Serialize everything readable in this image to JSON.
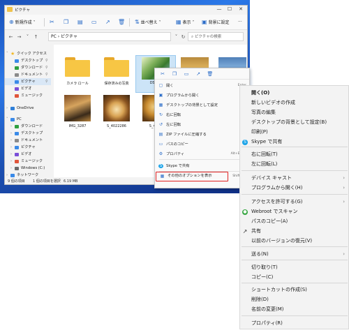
{
  "window": {
    "title": "ピクチャ",
    "controls": [
      "—",
      "☐",
      "✕"
    ]
  },
  "toolbar": {
    "new_label": "新規作成",
    "sort_label": "並べ替え",
    "view_label": "表示",
    "wallpaper_label": "背景に設定",
    "more_label": "···"
  },
  "address": {
    "path": "PC › ピクチャ",
    "search_placeholder": "ピクチャの検索"
  },
  "sidebar": {
    "items": [
      {
        "label": "クイック アクセス",
        "icon": "star-icon",
        "color": "#f2b824"
      },
      {
        "label": "デスクトップ",
        "icon": "desktop-icon",
        "color": "#3a8ae8"
      },
      {
        "label": "ダウンロード",
        "icon": "download-icon",
        "color": "#2f9f3f"
      },
      {
        "label": "ドキュメント",
        "icon": "document-icon",
        "color": "#8a8a8a"
      },
      {
        "label": "ピクチャ",
        "icon": "pictures-icon",
        "color": "#3a8ae8"
      },
      {
        "label": "ビデオ",
        "icon": "video-icon",
        "color": "#7b4ed8"
      },
      {
        "label": "ミュージック",
        "icon": "music-icon",
        "color": "#e0553a"
      },
      {
        "label": "OneDrive",
        "icon": "cloud-icon",
        "color": "#2f7fd8"
      },
      {
        "label": "PC",
        "icon": "pc-icon",
        "color": "#3a8ae8"
      },
      {
        "label": "ダウンロード",
        "icon": "download-icon",
        "color": "#2f9f3f"
      },
      {
        "label": "デスクトップ",
        "icon": "desktop-icon",
        "color": "#3a8ae8"
      },
      {
        "label": "ドキュメント",
        "icon": "document-icon",
        "color": "#8a8a8a"
      },
      {
        "label": "ピクチャ",
        "icon": "pictures-icon",
        "color": "#3a8ae8"
      },
      {
        "label": "ビデオ",
        "icon": "video-icon",
        "color": "#7b4ed8"
      },
      {
        "label": "ミュージック",
        "icon": "music-icon",
        "color": "#e0553a"
      },
      {
        "label": "Windows (C:)",
        "icon": "drive-icon",
        "color": "#6b6b6b"
      },
      {
        "label": "ネットワーク",
        "icon": "network-icon",
        "color": "#3a8ae8"
      }
    ]
  },
  "files": [
    {
      "name": "カメラ ロール",
      "kind": "folder"
    },
    {
      "name": "保存済みの写真",
      "kind": "folder"
    },
    {
      "name": "DSCF0",
      "kind": "photo"
    },
    {
      "name": "",
      "kind": "photo"
    },
    {
      "name": "",
      "kind": "photo"
    },
    {
      "name": "IMG_3287",
      "kind": "photo"
    },
    {
      "name": "S_4022286",
      "kind": "photo"
    },
    {
      "name": "S_4022",
      "kind": "photo"
    }
  ],
  "status": {
    "items": "9 個の項目",
    "selected": "1 個の項目を選択",
    "size": "6.19 MB"
  },
  "context_menu_small": {
    "items": [
      {
        "label": "開く",
        "shortcut": "Enter",
        "icon": "open-icon"
      },
      {
        "label": "プログラムから開く",
        "shortcut": "",
        "icon": "open-with-icon"
      },
      {
        "label": "デスクトップの背景として設定",
        "shortcut": "",
        "icon": "wallpaper-icon"
      },
      {
        "label": "右に回転",
        "shortcut": "",
        "icon": "rotate-right-icon"
      },
      {
        "label": "左に回転",
        "shortcut": "",
        "icon": "rotate-left-icon"
      },
      {
        "label": "ZIP ファイルに圧縮する",
        "shortcut": "",
        "icon": "zip-icon"
      },
      {
        "label": "パスのコピー",
        "shortcut": "",
        "icon": "copy-path-icon"
      },
      {
        "label": "プロパティ",
        "shortcut": "Alt+Enter",
        "icon": "properties-icon"
      },
      {
        "label": "Skype で共有",
        "shortcut": "",
        "icon": "skype-icon"
      },
      {
        "label": "その他のオプションを表示",
        "shortcut": "Shift+F10",
        "icon": "more-options-icon"
      }
    ]
  },
  "context_menu_large": {
    "items": [
      {
        "label": "開く(O)",
        "bold": true
      },
      {
        "label": "新しいビデオの作成"
      },
      {
        "label": "写真の編集"
      },
      {
        "label": "デスクトップの背景として設定(B)"
      },
      {
        "label": "印刷(P)"
      },
      {
        "label": "Skype で共有",
        "icon": "skype-icon"
      },
      {
        "label": "右に回転(T)"
      },
      {
        "label": "左に回転(L)"
      },
      {
        "label": "デバイス キャスト",
        "submenu": true
      },
      {
        "label": "プログラムから開く(H)",
        "submenu": true
      },
      {
        "label": "アクセスを許可する(G)",
        "submenu": true
      },
      {
        "label": "Webroot でスキャン",
        "icon": "webroot-icon"
      },
      {
        "label": "パスのコピー(A)"
      },
      {
        "label": "共有",
        "icon": "share-icon"
      },
      {
        "label": "以前のバージョンの復元(V)"
      },
      {
        "label": "送る(N)",
        "submenu": true
      },
      {
        "label": "切り取り(T)"
      },
      {
        "label": "コピー(C)"
      },
      {
        "label": "ショートカットの作成(S)"
      },
      {
        "label": "削除(D)"
      },
      {
        "label": "名前の変更(M)"
      },
      {
        "label": "プロパティ(R)"
      }
    ]
  },
  "colors": {
    "accent": "#2a6cc8",
    "highlight_box": "#e02020",
    "skype": "#1aa3e8",
    "webroot": "#3aa845"
  }
}
